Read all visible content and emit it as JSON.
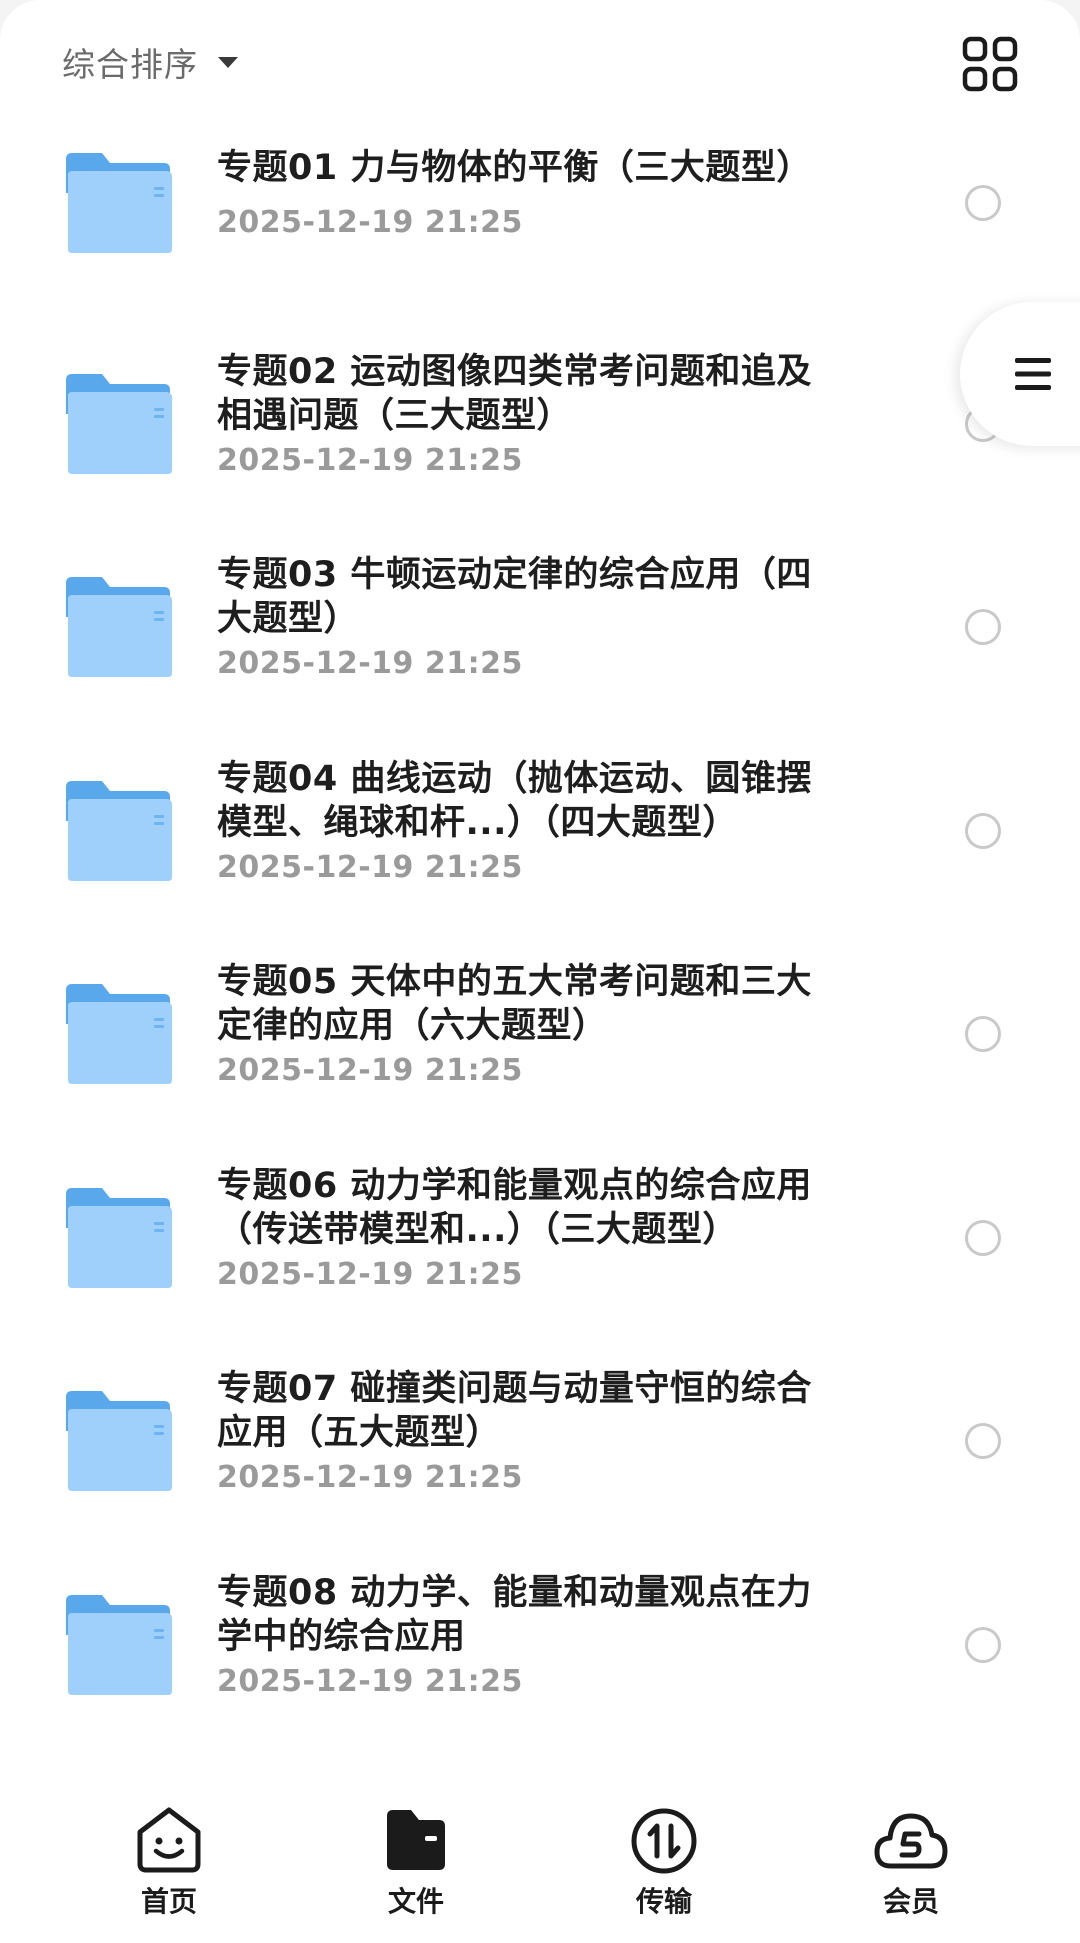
{
  "sort": {
    "label": "综合排序"
  },
  "folders": [
    {
      "title": "专题01 力与物体的平衡（三大题型）",
      "date": "2025-12-19 21:25"
    },
    {
      "title": "专题02 运动图像四类常考问题和追及相遇问题（三大题型）",
      "date": "2025-12-19 21:25"
    },
    {
      "title": "专题03 牛顿运动定律的综合应用（四大题型）",
      "date": "2025-12-19 21:25"
    },
    {
      "title": "专题04 曲线运动（抛体运动、圆锥摆模型、绳球和杆...）（四大题型）",
      "date": "2025-12-19 21:25"
    },
    {
      "title": "专题05 天体中的五大常考问题和三大定律的应用（六大题型）",
      "date": "2025-12-19 21:25"
    },
    {
      "title": "专题06 动力学和能量观点的综合应用（传送带模型和...）（三大题型）",
      "date": "2025-12-19 21:25"
    },
    {
      "title": "专题07 碰撞类问题与动量守恒的综合应用（五大题型）",
      "date": "2025-12-19 21:25"
    },
    {
      "title": "专题08 动力学、能量和动量观点在力学中的综合应用",
      "date": "2025-12-19 21:25"
    }
  ],
  "nav": {
    "home": "首页",
    "files": "文件",
    "transfer": "传输",
    "member": "会员"
  },
  "colors": {
    "folder_back": "#5aa8ec",
    "folder_front": "#9fd0fb",
    "icon_dark": "#1b1b1b"
  },
  "icons": {
    "sort_caret": "caret-down-icon",
    "view_toggle": "grid-view-icon",
    "side_menu": "menu-icon",
    "folder": "folder-icon"
  }
}
